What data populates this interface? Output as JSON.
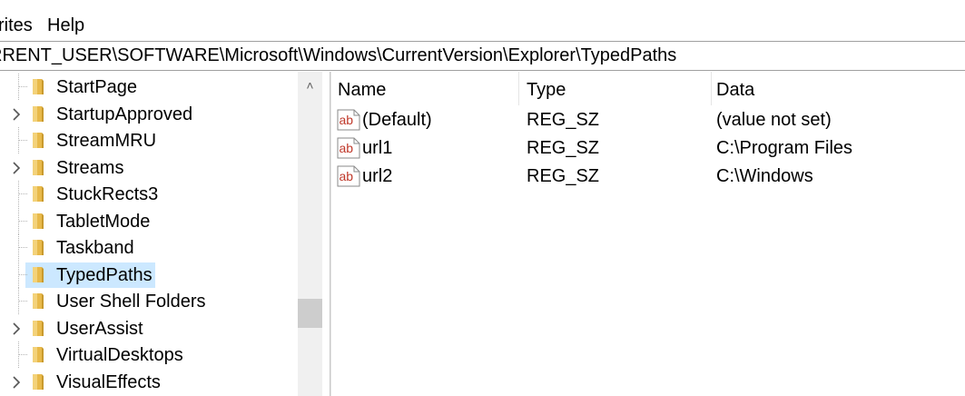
{
  "menubar": {
    "items": [
      "rites",
      "Help"
    ]
  },
  "address": {
    "path": "RRENT_USER\\SOFTWARE\\Microsoft\\Windows\\CurrentVersion\\Explorer\\TypedPaths"
  },
  "tree": {
    "items": [
      {
        "label": "StartPage",
        "expandable": false
      },
      {
        "label": "StartupApproved",
        "expandable": true
      },
      {
        "label": "StreamMRU",
        "expandable": false
      },
      {
        "label": "Streams",
        "expandable": true
      },
      {
        "label": "StuckRects3",
        "expandable": false
      },
      {
        "label": "TabletMode",
        "expandable": false
      },
      {
        "label": "Taskband",
        "expandable": false
      },
      {
        "label": "TypedPaths",
        "expandable": false,
        "selected": true
      },
      {
        "label": "User Shell Folders",
        "expandable": false
      },
      {
        "label": "UserAssist",
        "expandable": true
      },
      {
        "label": "VirtualDesktops",
        "expandable": false
      },
      {
        "label": "VisualEffects",
        "expandable": true
      }
    ]
  },
  "list": {
    "columns": [
      "Name",
      "Type",
      "Data"
    ],
    "rows": [
      {
        "name": "(Default)",
        "type": "REG_SZ",
        "data": "(value not set)"
      },
      {
        "name": "url1",
        "type": "REG_SZ",
        "data": "C:\\Program Files"
      },
      {
        "name": "url2",
        "type": "REG_SZ",
        "data": "C:\\Windows"
      }
    ]
  },
  "icons": {
    "expander": "chevron-right-icon",
    "folder": "folder-icon",
    "value": "string-value-icon",
    "scroll_up": "chevron-up-icon"
  },
  "colors": {
    "selection": "#cce8ff",
    "folder": "#e8b94a",
    "string_icon": "#c0392b"
  }
}
